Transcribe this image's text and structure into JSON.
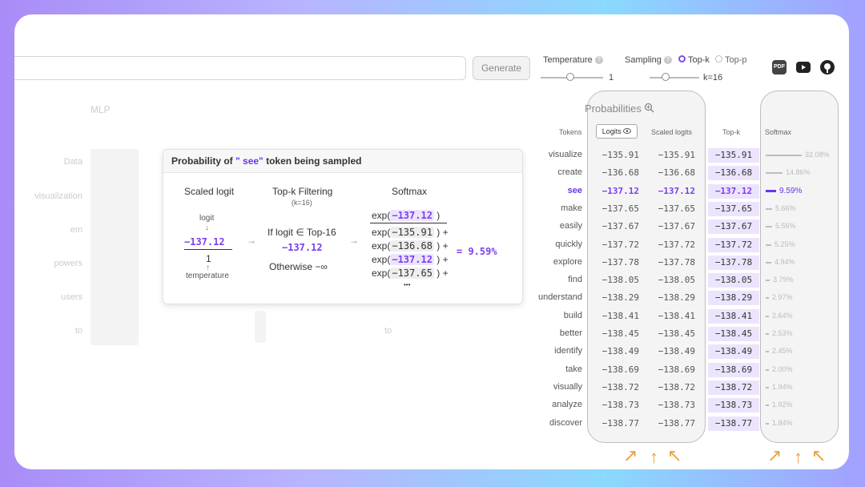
{
  "header": {
    "generate_label": "Generate",
    "temperature_label": "Temperature",
    "temperature_value": "1",
    "sampling_label": "Sampling",
    "topk_label": "Top-k",
    "topp_label": "Top-p",
    "k_value": "k=16",
    "help_glyph": "?",
    "icons": [
      "pdf-icon",
      "youtube-icon",
      "github-icon"
    ],
    "pdf_text": "PDF"
  },
  "background": {
    "mlp_label": "MLP",
    "tokens": [
      "Data",
      "visualization",
      "em",
      "powers",
      "users",
      "to"
    ],
    "right_token": "to"
  },
  "tooltip": {
    "title_prefix": "Probability of",
    "title_token": "\" see\"",
    "title_suffix": "token being sampled",
    "scaled_logit_label": "Scaled logit",
    "logit_word": "logit",
    "logit_value": "−137.12",
    "denominator": "1",
    "temperature_word": "temperature",
    "topk_label": "Top-k Filtering",
    "topk_sub": "(k=16)",
    "condition": "If logit ∈ Top-16",
    "cond_value": "−137.12",
    "otherwise": "Otherwise −∞",
    "softmax_label": "Softmax",
    "numerator": "−137.12",
    "denominator_terms": [
      "−135.91",
      "−136.68",
      "−137.12",
      "−137.65"
    ],
    "ellipsis": "•••",
    "result": "= 9.59%",
    "arrow": "→",
    "down_arrow": "↓",
    "up_arrow": "↑",
    "exp_open": "exp(",
    "exp_close": ")",
    "plus": "+"
  },
  "panel": {
    "title": "Probabilities",
    "tokens_header": "Tokens",
    "logits_header": "Logits",
    "scaled_header": "Scaled logits",
    "topk_header": "Top-k",
    "softmax_header": "Softmax",
    "rows": [
      {
        "token": "visualize",
        "logit": "−135.91",
        "scaled": "−135.91",
        "topk": "−135.91",
        "pct": "32.08%",
        "frac": 0.3208
      },
      {
        "token": "create",
        "logit": "−136.68",
        "scaled": "−136.68",
        "topk": "−136.68",
        "pct": "14.86%",
        "frac": 0.1486
      },
      {
        "token": "see",
        "logit": "−137.12",
        "scaled": "−137.12",
        "topk": "−137.12",
        "pct": "9.59%",
        "frac": 0.0959,
        "selected": true
      },
      {
        "token": "make",
        "logit": "−137.65",
        "scaled": "−137.65",
        "topk": "−137.65",
        "pct": "5.66%",
        "frac": 0.0566
      },
      {
        "token": "easily",
        "logit": "−137.67",
        "scaled": "−137.67",
        "topk": "−137.67",
        "pct": "5.56%",
        "frac": 0.0556
      },
      {
        "token": "quickly",
        "logit": "−137.72",
        "scaled": "−137.72",
        "topk": "−137.72",
        "pct": "5.25%",
        "frac": 0.0525
      },
      {
        "token": "explore",
        "logit": "−137.78",
        "scaled": "−137.78",
        "topk": "−137.78",
        "pct": "4.94%",
        "frac": 0.0494
      },
      {
        "token": "find",
        "logit": "−138.05",
        "scaled": "−138.05",
        "topk": "−138.05",
        "pct": "3.79%",
        "frac": 0.0379
      },
      {
        "token": "understand",
        "logit": "−138.29",
        "scaled": "−138.29",
        "topk": "−138.29",
        "pct": "2.97%",
        "frac": 0.0297
      },
      {
        "token": "build",
        "logit": "−138.41",
        "scaled": "−138.41",
        "topk": "−138.41",
        "pct": "2.64%",
        "frac": 0.0264
      },
      {
        "token": "better",
        "logit": "−138.45",
        "scaled": "−138.45",
        "topk": "−138.45",
        "pct": "2.53%",
        "frac": 0.0253
      },
      {
        "token": "identify",
        "logit": "−138.49",
        "scaled": "−138.49",
        "topk": "−138.49",
        "pct": "2.45%",
        "frac": 0.0245
      },
      {
        "token": "take",
        "logit": "−138.69",
        "scaled": "−138.69",
        "topk": "−138.69",
        "pct": "2.00%",
        "frac": 0.02
      },
      {
        "token": "visually",
        "logit": "−138.72",
        "scaled": "−138.72",
        "topk": "−138.72",
        "pct": "1.94%",
        "frac": 0.0194
      },
      {
        "token": "analyze",
        "logit": "−138.73",
        "scaled": "−138.73",
        "topk": "−138.73",
        "pct": "1.92%",
        "frac": 0.0192
      },
      {
        "token": "discover",
        "logit": "−138.77",
        "scaled": "−138.77",
        "topk": "−138.77",
        "pct": "1.84%",
        "frac": 0.0184
      }
    ]
  },
  "colors": {
    "accent": "#7a3ff0",
    "topk_bg": "#ece4fd",
    "arrows": "#e8a040"
  }
}
